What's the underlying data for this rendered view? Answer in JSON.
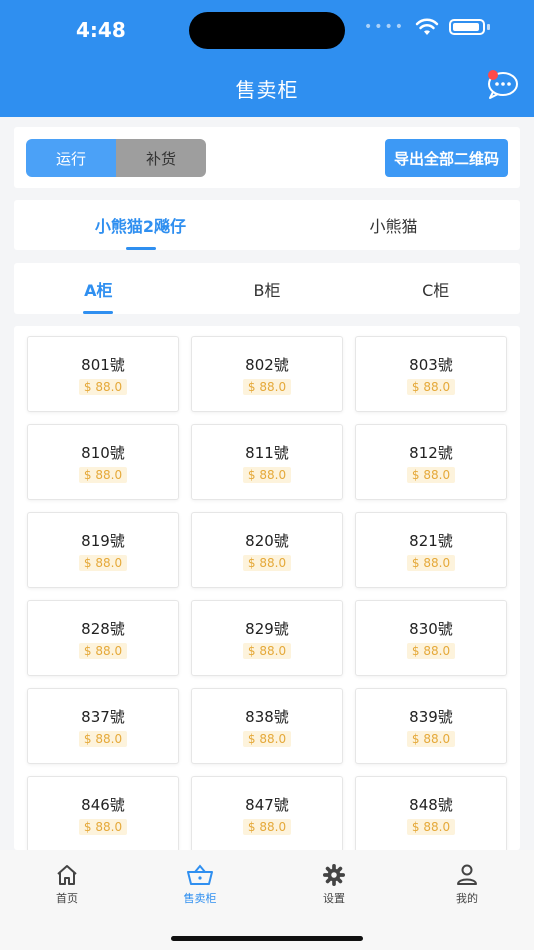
{
  "status": {
    "time": "4:48"
  },
  "nav": {
    "title": "售卖柜"
  },
  "toolbar": {
    "seg_run": "运行",
    "seg_restock": "补货",
    "export_label": "导出全部二维码"
  },
  "store_tabs": [
    "小熊猫2飚仔",
    "小熊猫"
  ],
  "cabinet_tabs": [
    "A柜",
    "B柜",
    "C柜"
  ],
  "slots": [
    {
      "name": "801號",
      "price": "$ 88.0"
    },
    {
      "name": "802號",
      "price": "$ 88.0"
    },
    {
      "name": "803號",
      "price": "$ 88.0"
    },
    {
      "name": "810號",
      "price": "$ 88.0"
    },
    {
      "name": "811號",
      "price": "$ 88.0"
    },
    {
      "name": "812號",
      "price": "$ 88.0"
    },
    {
      "name": "819號",
      "price": "$ 88.0"
    },
    {
      "name": "820號",
      "price": "$ 88.0"
    },
    {
      "name": "821號",
      "price": "$ 88.0"
    },
    {
      "name": "828號",
      "price": "$ 88.0"
    },
    {
      "name": "829號",
      "price": "$ 88.0"
    },
    {
      "name": "830號",
      "price": "$ 88.0"
    },
    {
      "name": "837號",
      "price": "$ 88.0"
    },
    {
      "name": "838號",
      "price": "$ 88.0"
    },
    {
      "name": "839號",
      "price": "$ 88.0"
    },
    {
      "name": "846號",
      "price": "$ 88.0"
    },
    {
      "name": "847號",
      "price": "$ 88.0"
    },
    {
      "name": "848號",
      "price": "$ 88.0"
    }
  ],
  "tabbar": [
    "首页",
    "售卖柜",
    "设置",
    "我的"
  ],
  "colors": {
    "primary": "#2f8ff0",
    "price": "#e5a93a"
  }
}
